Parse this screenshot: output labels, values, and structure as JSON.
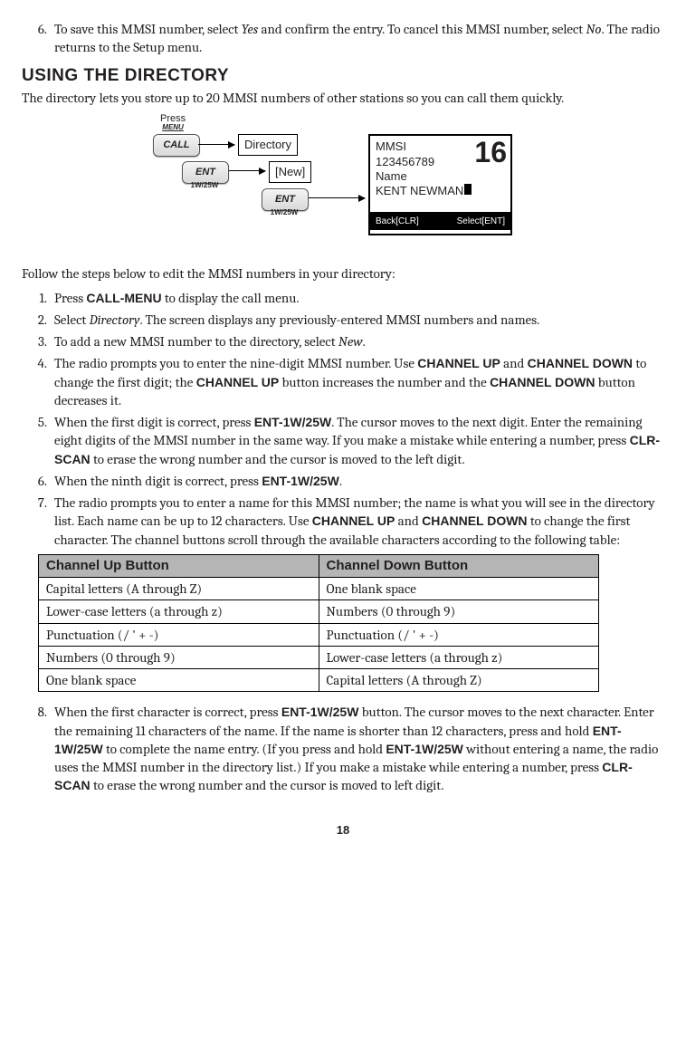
{
  "prior_step": {
    "num": "6.",
    "text_parts": [
      "To save this MMSI number, select ",
      "Yes",
      " and confirm the entry. To cancel this MMSI number, select ",
      "No",
      ". The radio returns to the Setup menu."
    ]
  },
  "section_heading": "USING THE DIRECTORY",
  "intro": "The directory lets you store up to 20 MMSI numbers of other stations so you can call them quickly.",
  "diagram": {
    "press": "Press",
    "menu": "MENU",
    "call_btn": "CALL",
    "ent_btn": "ENT",
    "ent_sub": "1W/25W",
    "directory_box": "Directory",
    "new_box": "[New]",
    "screen": {
      "line1": "MMSI",
      "line2": "123456789",
      "line3": "Name",
      "line4": "KENT NEWMAN",
      "big": "16",
      "back": "Back[CLR]",
      "select": "Select[ENT]"
    }
  },
  "follow_line": "Follow the steps below to edit the MMSI numbers in your directory:",
  "steps": [
    {
      "pre": "Press ",
      "b1": "CALL-MENU",
      "post": " to display the call menu."
    },
    {
      "pre": "Select ",
      "i1": "Directory",
      "post": ". The screen displays any previously-entered MMSI numbers and names."
    },
    {
      "pre": "To add a new MMSI number to the directory, select ",
      "i1": "New",
      "post": "."
    },
    {
      "pre": "The radio prompts you to enter the nine-digit MMSI number. Use ",
      "b1": "CHANNEL UP",
      "mid1": " and ",
      "b2": "CHANNEL DOWN",
      "mid2": " to change the first digit; the ",
      "b3": "CHANNEL UP",
      "mid3": " button increases the number and the ",
      "b4": "CHANNEL DOWN",
      "post": " button decreases it."
    },
    {
      "pre": "When the first digit is correct, press ",
      "b1": "ENT-1W/25W",
      "mid1": ". The cursor moves to the next digit. Enter the remaining eight digits of the MMSI number in the same way.  If you make a mistake while entering a number, press ",
      "b2": "CLR-SCAN",
      "post": " to erase the wrong number and the cursor is moved to the left digit."
    },
    {
      "pre": "When the ninth digit is correct, press ",
      "b1": "ENT-1W/25W",
      "post": "."
    },
    {
      "pre": "The radio prompts you to enter a name for this MMSI number; the name is what you will see in the directory list. Each name can be up to 12 characters. Use ",
      "b1": "CHANNEL UP",
      "mid1": " and ",
      "b2": "CHANNEL DOWN",
      "post": " to change the first character. The channel buttons scroll through the available characters according to the following table:"
    }
  ],
  "table": {
    "head_up": "Channel Up Button",
    "head_down": "Channel Down Button",
    "rows": [
      {
        "up": "Capital letters (A through Z)",
        "down": "One blank space"
      },
      {
        "up": "Lower-case letters (a through z)",
        "down": "Numbers (0 through 9)"
      },
      {
        "up": "Punctuation (/ ' + -)",
        "down": "Punctuation (/ ' + -)"
      },
      {
        "up": "Numbers (0 through 9)",
        "down": "Lower-case letters (a through z)"
      },
      {
        "up": "One blank space",
        "down": "Capital letters (A through Z)"
      }
    ]
  },
  "step8": {
    "pre": "When the first character is correct, press ",
    "b1": "ENT-1W/25W",
    "mid1": " button. The cursor moves to the next character. Enter the remaining 11 characters of the name. If the name is shorter than 12 characters, press and hold ",
    "b2": "ENT-1W/25W",
    "mid2": " to complete the name entry. (If you press and hold ",
    "b3": "ENT-1W/25W",
    "mid3": " without entering a name, the radio uses the MMSI number in the directory list.) If you make a mistake while entering a number, press ",
    "b4": "CLR-SCAN",
    "post": " to erase the wrong number and the cursor is moved to left digit."
  },
  "page_number": "18"
}
